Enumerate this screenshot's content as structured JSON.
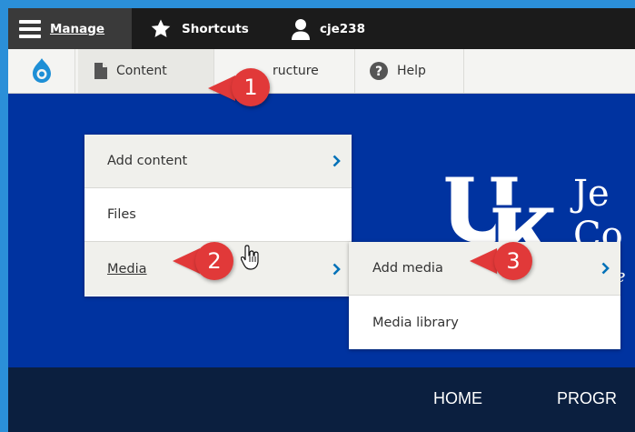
{
  "toolbar": {
    "manage_label": "Manage",
    "shortcuts_label": "Shortcuts",
    "user_label": "cje238"
  },
  "tray": {
    "content_label": "Content",
    "structure_label": "ructure",
    "help_label": "Help"
  },
  "content_menu": {
    "items": [
      {
        "label": "Add content",
        "has_submenu": true
      },
      {
        "label": "Files",
        "has_submenu": false
      },
      {
        "label": "Media",
        "has_submenu": true
      }
    ]
  },
  "media_menu": {
    "items": [
      {
        "label": "Add media",
        "has_submenu": true
      },
      {
        "label": "Media library",
        "has_submenu": false
      }
    ]
  },
  "banner": {
    "brand_line1": "Je",
    "brand_line2": "Co",
    "brand_line3": "lle"
  },
  "nav": {
    "home_label": "HOME",
    "programs_label": "PROGR"
  },
  "callouts": [
    "1",
    "2",
    "3"
  ],
  "colors": {
    "toolbar": "#1b1b1b",
    "banner_blue": "#0033a0",
    "nav_dark": "#0b1f3f",
    "callout_red": "#e13939",
    "link_blue": "#0071b8"
  }
}
